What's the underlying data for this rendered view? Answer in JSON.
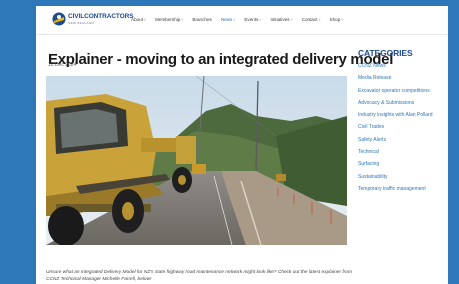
{
  "nav": {
    "logo_text": "CIVILCONTRACTORS",
    "logo_sub": "NEW ZEALAND",
    "items": [
      {
        "label": "About",
        "caret": "˅"
      },
      {
        "label": "Membership",
        "caret": "˅"
      },
      {
        "label": "Branches",
        "caret": ""
      },
      {
        "label": "News",
        "caret": "˅"
      },
      {
        "label": "Events",
        "caret": "˅"
      },
      {
        "label": "Initiatives",
        "caret": "˅"
      },
      {
        "label": "Contact",
        "caret": "˅"
      },
      {
        "label": "Shop",
        "caret": "˅"
      }
    ],
    "active_index": 3
  },
  "article": {
    "title": "Explainer - moving to an integrated delivery model",
    "date": "12 Dec 2024",
    "intro": "Unsure what an Integrated Delivery Model for NZ's state highway road maintenance network might look like? Check out the latest explainer from CCNZ Technical Manager Michelle Farrell, below!"
  },
  "sidebar": {
    "heading": "CATEGORIES",
    "categories": [
      "CCNZ News",
      "Media Release",
      "Excavator operator competitions",
      "Advocacy & Submissions",
      "Industry insights with Alan Pollard",
      "Civil Trades",
      "Safety Alerts",
      "Technical",
      "Surfacing",
      "Sustainability",
      "Temporary traffic management"
    ]
  },
  "colors": {
    "background": "#2e77b8",
    "accent": "#2e77b8",
    "brand": "#1e4b8f"
  }
}
